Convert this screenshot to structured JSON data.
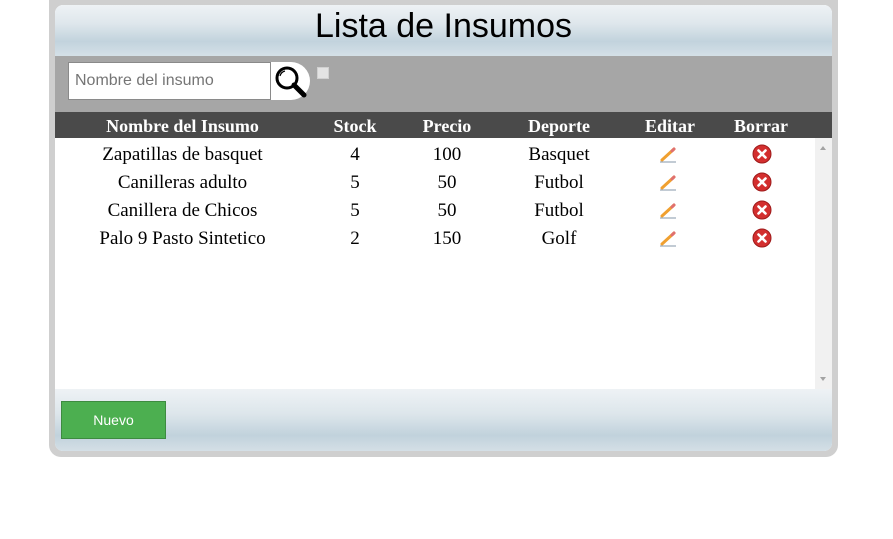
{
  "page": {
    "title": "Lista de Insumos"
  },
  "search": {
    "placeholder": "Nombre del insumo",
    "value": ""
  },
  "table": {
    "headers": [
      "Nombre del Insumo",
      "Stock",
      "Precio",
      "Deporte",
      "Editar",
      "Borrar"
    ],
    "rows": [
      {
        "nombre": "Zapatillas de basquet",
        "stock": "4",
        "precio": "100",
        "deporte": "Basquet"
      },
      {
        "nombre": "Canilleras adulto",
        "stock": "5",
        "precio": "50",
        "deporte": "Futbol"
      },
      {
        "nombre": "Canillera de Chicos",
        "stock": "5",
        "precio": "50",
        "deporte": "Futbol"
      },
      {
        "nombre": "Palo 9 Pasto Sintetico",
        "stock": "2",
        "precio": "150",
        "deporte": "Golf"
      }
    ]
  },
  "footer": {
    "new_label": "Nuevo"
  },
  "icons": {
    "search": "magnifier-icon",
    "edit": "pencil-icon",
    "delete": "delete-x-icon"
  },
  "colors": {
    "header_row": "#4a4a4a",
    "toolbar": "#a6a6a6",
    "primary_button": "#4caf50",
    "delete_icon": "#d32f2f"
  }
}
